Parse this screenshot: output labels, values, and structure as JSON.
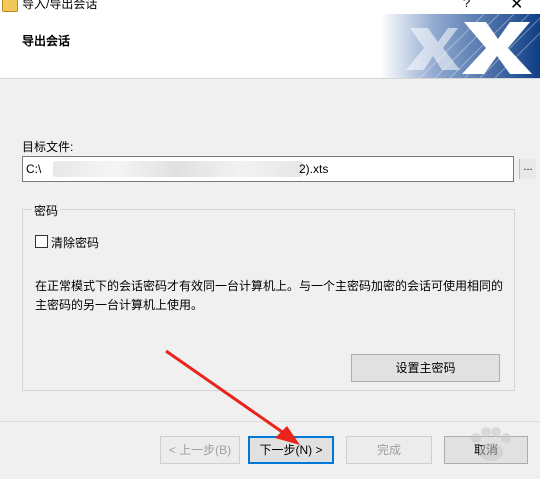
{
  "window": {
    "title": "导入/导出会话",
    "help_glyph": "?",
    "close_glyph": "✕"
  },
  "header": {
    "title": "导出会话"
  },
  "target": {
    "label": "目标文件:",
    "value_prefix": "C:\\",
    "value_suffix": "2).xts",
    "browse_label": "..."
  },
  "password": {
    "legend": "密码",
    "clear_label": "清除密码",
    "clear_checked": false,
    "description": "在正常模式下的会话密码才有效同一台计算机上。与一个主密码加密的会话可使用相同的主密码的另一台计算机上使用。",
    "set_master_label": "设置主密码"
  },
  "buttons": {
    "prev": "< 上一步(B)",
    "next": "下一步(N) >",
    "finish": "完成",
    "cancel": "取消"
  },
  "colors": {
    "accent": "#0078d7",
    "arrow": "#e8241c",
    "logo": "#0f3f86"
  }
}
